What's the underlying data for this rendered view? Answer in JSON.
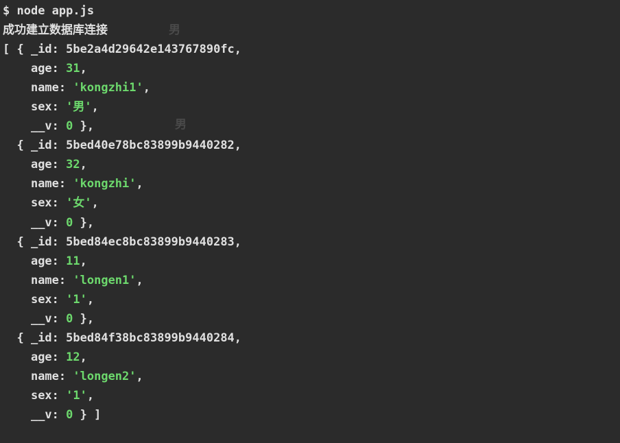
{
  "prompt": "$",
  "command": "node app.js",
  "connection_message": "成功建立数据库连接",
  "ghost_text": "男",
  "records": [
    {
      "_id": "5be2a4d29642e143767890fc",
      "age": 31,
      "name": "'kongzhi1'",
      "sex": "'男'",
      "__v": 0
    },
    {
      "_id": "5bed40e78bc83899b9440282",
      "age": 32,
      "name": "'kongzhi'",
      "sex": "'女'",
      "__v": 0
    },
    {
      "_id": "5bed84ec8bc83899b9440283",
      "age": 11,
      "name": "'longen1'",
      "sex": "'1'",
      "__v": 0
    },
    {
      "_id": "5bed84f38bc83899b9440284",
      "age": 12,
      "name": "'longen2'",
      "sex": "'1'",
      "__v": 0
    }
  ],
  "keys": {
    "id": "_id",
    "age": "age",
    "name": "name",
    "sex": "sex",
    "v": "__v"
  }
}
